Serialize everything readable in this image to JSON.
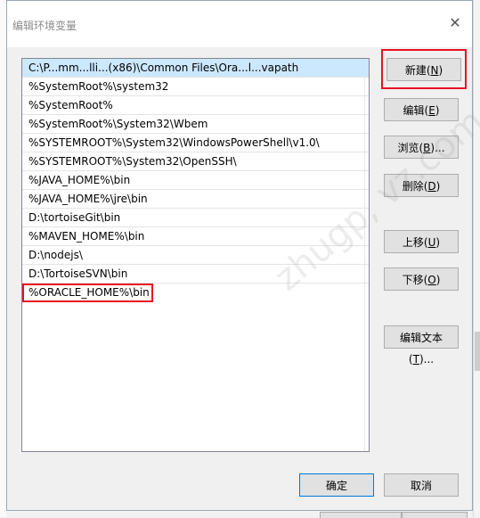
{
  "dialog": {
    "title": "编辑环境变量",
    "close_glyph": "✕"
  },
  "path_list": {
    "items": [
      "C:\\P...mm...lli...(x86)\\Common Files\\Ora...l...vapath",
      "%SystemRoot%\\system32",
      "%SystemRoot%",
      "%SystemRoot%\\System32\\Wbem",
      "%SYSTEMROOT%\\System32\\WindowsPowerShell\\v1.0\\",
      "%SYSTEMROOT%\\System32\\OpenSSH\\",
      "%JAVA_HOME%\\bin",
      "%JAVA_HOME%\\jre\\bin",
      "D:\\tortoiseGit\\bin",
      "%MAVEN_HOME%\\bin",
      "D:\\nodejs\\",
      "D:\\TortoiseSVN\\bin",
      "%ORACLE_HOME%\\bin"
    ]
  },
  "buttons": {
    "new": {
      "label": "新建(",
      "key": "N",
      "end": ")"
    },
    "edit": {
      "label": "编辑(",
      "key": "E",
      "end": ")"
    },
    "browse": {
      "label": "浏览(",
      "key": "B",
      "end": ")..."
    },
    "delete": {
      "label": "删除(",
      "key": "D",
      "end": ")"
    },
    "move_up": {
      "label": "上移(",
      "key": "U",
      "end": ")"
    },
    "move_down": {
      "label": "下移(",
      "key": "O",
      "end": ")"
    },
    "edit_text": {
      "label": "编辑文本(",
      "key": "T",
      "end": ")..."
    },
    "ok": {
      "label": "确定"
    },
    "cancel": {
      "label": "取消"
    }
  },
  "watermark": "zhugp, vz.com",
  "colors": {
    "highlight_red": "#e81123",
    "selection": "#cce8ff",
    "focus_blue": "#0078d7"
  }
}
